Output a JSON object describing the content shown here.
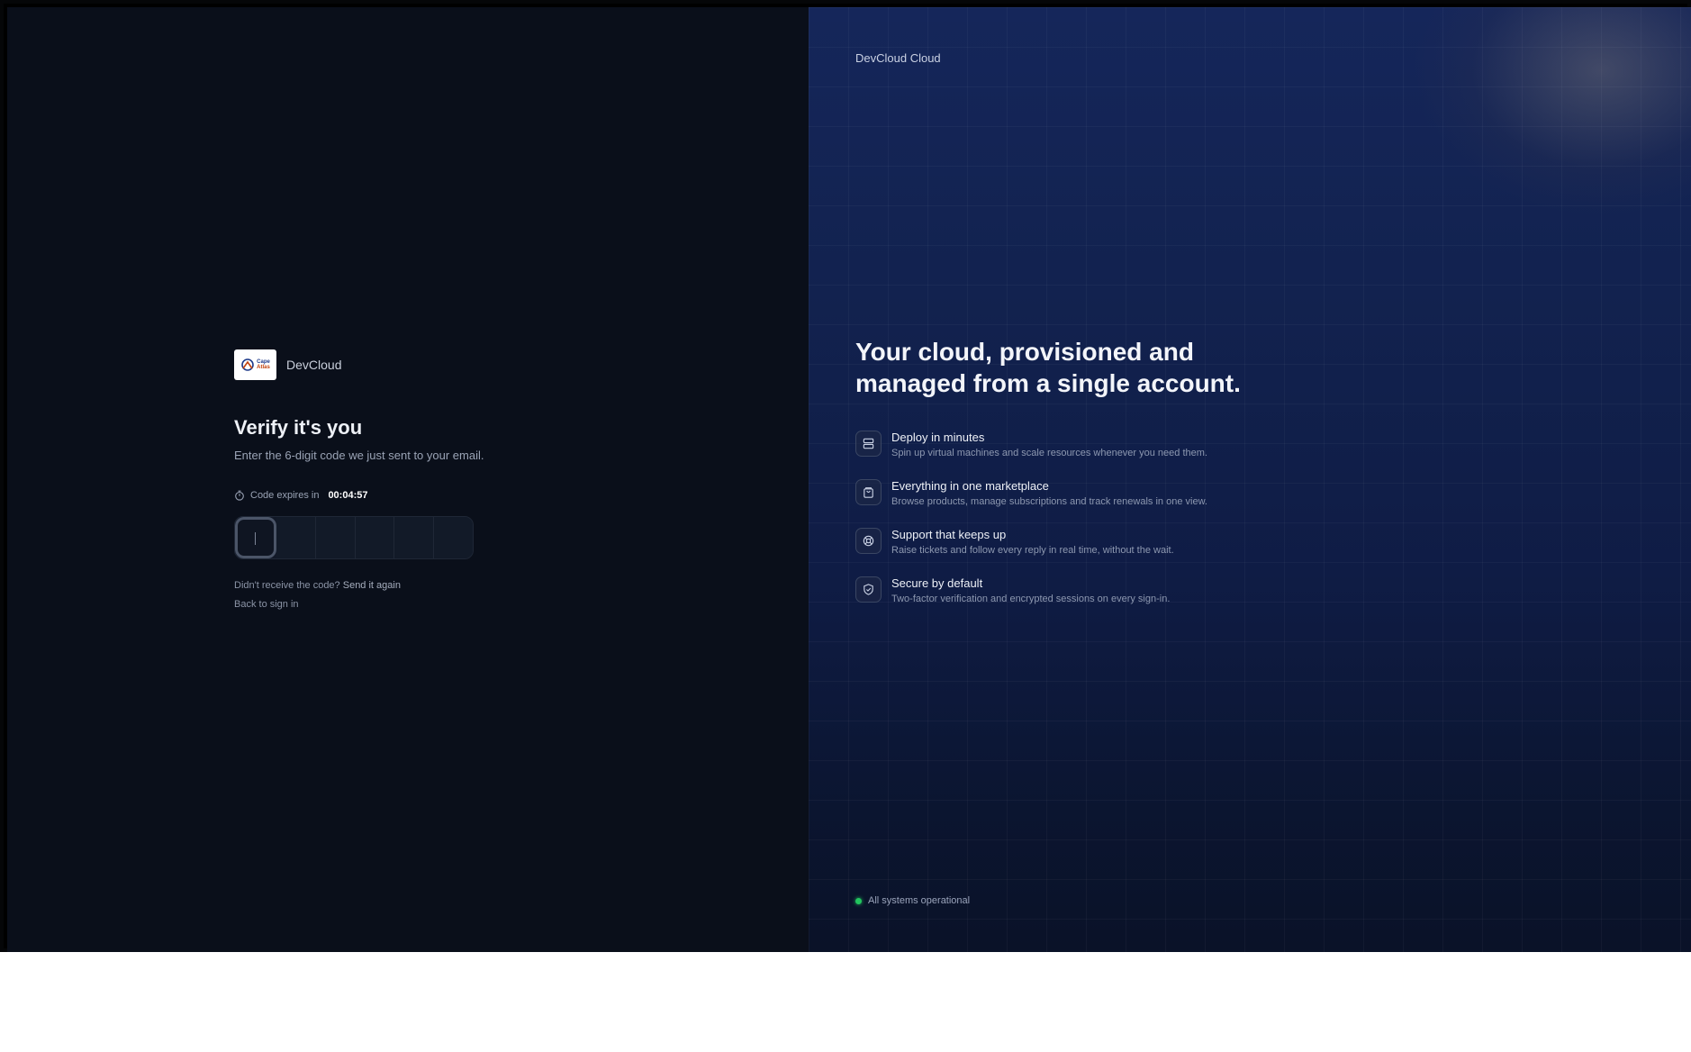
{
  "left": {
    "brand": {
      "name": "DevCloud",
      "logo_text_1": "Cape",
      "logo_text_2": "Atlas"
    },
    "title": "Verify it's you",
    "subtitle": "Enter the 6-digit code we just sent to your email.",
    "expires": {
      "label": "Code expires in",
      "time": "00:04:57",
      "icon": "timer-icon"
    },
    "otp": {
      "digits": 6,
      "values": [
        "",
        "",
        "",
        "",
        "",
        ""
      ]
    },
    "resend": {
      "prompt": "Didn't receive the code?",
      "link": "Send it again"
    },
    "back": "Back to sign in"
  },
  "right": {
    "brand": "DevCloud Cloud",
    "headline": "Your cloud, provisioned and managed from a single account.",
    "features": [
      {
        "icon": "server-icon",
        "title": "Deploy in minutes",
        "desc": "Spin up virtual machines and scale resources whenever you need them."
      },
      {
        "icon": "shopping-bag-icon",
        "title": "Everything in one marketplace",
        "desc": "Browse products, manage subscriptions and track renewals in one view."
      },
      {
        "icon": "lifebuoy-icon",
        "title": "Support that keeps up",
        "desc": "Raise tickets and follow every reply in real time, without the wait."
      },
      {
        "icon": "shield-check-icon",
        "title": "Secure by default",
        "desc": "Two-factor verification and encrypted sessions on every sign-in."
      }
    ],
    "status": {
      "text": "All systems operational",
      "color": "#22c55e"
    }
  },
  "colors": {
    "left_bg": "#0a0f1a",
    "right_bg": "#12224f",
    "accent": "#22c55e"
  }
}
